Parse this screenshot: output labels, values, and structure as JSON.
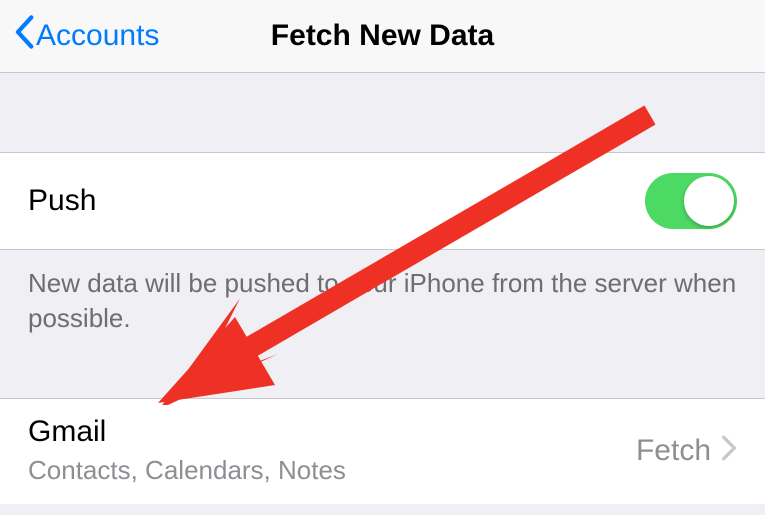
{
  "nav": {
    "back_label": "Accounts",
    "title": "Fetch New Data"
  },
  "push": {
    "label": "Push",
    "enabled": true,
    "description": "New data will be pushed to your iPhone from the server when possible."
  },
  "accounts": [
    {
      "name": "Gmail",
      "subtitle": "Contacts, Calendars, Notes",
      "mode": "Fetch"
    }
  ],
  "colors": {
    "accent": "#007aff",
    "toggle_on": "#4cd964",
    "annotation": "#ee3124"
  }
}
